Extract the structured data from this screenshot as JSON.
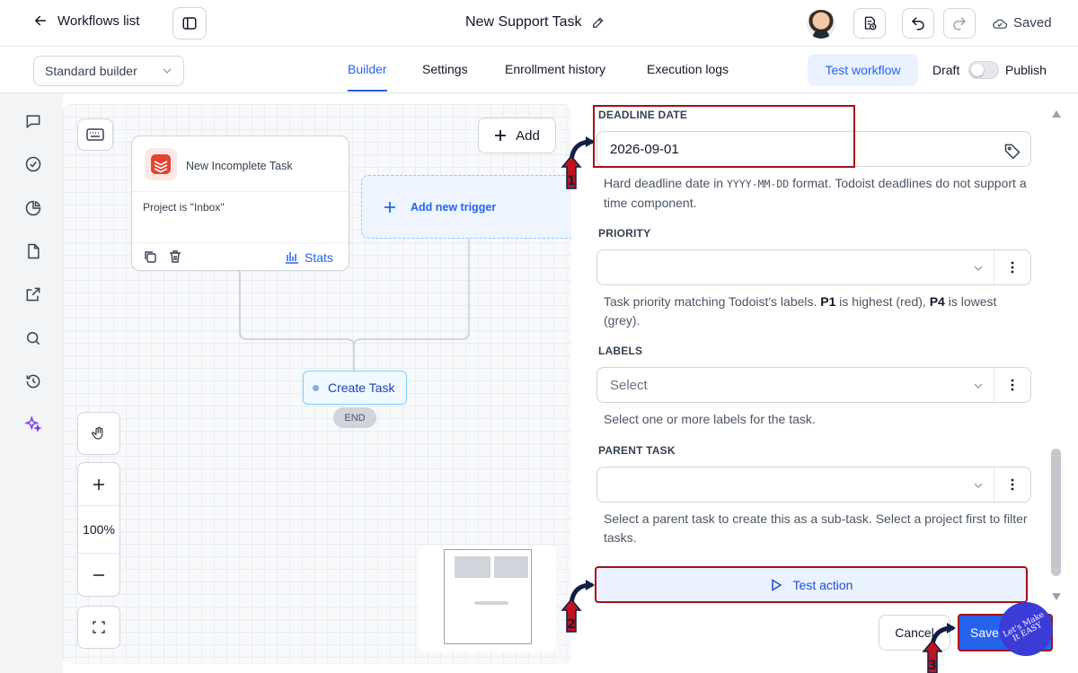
{
  "topbar": {
    "back_label": "Workflows list",
    "title": "New Support Task",
    "saved_label": "Saved"
  },
  "subbar": {
    "builder_select": "Standard builder",
    "tabs": [
      {
        "label": "Builder",
        "active": true
      },
      {
        "label": "Settings",
        "active": false
      },
      {
        "label": "Enrollment history",
        "active": false
      },
      {
        "label": "Execution logs",
        "active": false
      }
    ],
    "test_workflow": "Test workflow",
    "draft_label": "Draft",
    "publish_label": "Publish"
  },
  "sidebar": {
    "icons": [
      "chat-icon",
      "check-circle-icon",
      "pie-chart-icon",
      "file-icon",
      "external-link-icon",
      "search-icon",
      "history-icon",
      "sparkle-icon"
    ]
  },
  "canvas": {
    "add_label": "Add",
    "trigger": {
      "name": "New Incomplete Task",
      "condition": "Project is \"Inbox\"",
      "stats_label": "Stats"
    },
    "add_trigger_label": "Add new trigger",
    "action_node": "Create Task",
    "end_label": "END",
    "zoom_level": "100%"
  },
  "panel": {
    "deadline": {
      "label": "DEADLINE DATE",
      "value": "2026-09-01",
      "help_prefix": "Hard deadline date in ",
      "help_code": "YYYY-MM-DD",
      "help_suffix": " format. Todoist deadlines do not support a time component."
    },
    "priority": {
      "label": "PRIORITY",
      "value": "",
      "help_prefix": "Task priority matching Todoist's labels. ",
      "p1": "P1",
      "help_mid": " is highest (red), ",
      "p4": "P4",
      "help_suffix": " is lowest (grey)."
    },
    "labels": {
      "label": "LABELS",
      "placeholder": "Select",
      "help": "Select one or more labels for the task."
    },
    "parent_task": {
      "label": "PARENT TASK",
      "value": "",
      "help": "Select a parent task to create this as a sub-task. Select a project first to filter tasks."
    },
    "test_action": "Test action",
    "cancel_label": "Cancel",
    "save_label": "Save"
  },
  "markers": [
    "1",
    "2",
    "3"
  ],
  "watermark": "Let's Make It EASY",
  "colors": {
    "accent": "#2563eb",
    "highlight": "#a80f18",
    "marker_red": "#c1121f"
  }
}
